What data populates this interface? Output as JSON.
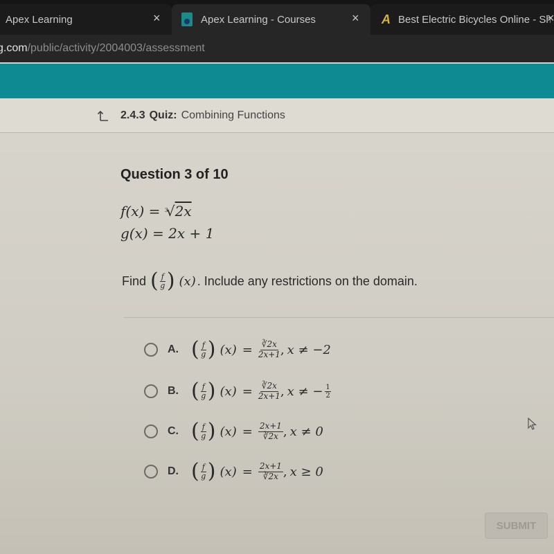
{
  "browser": {
    "tabs": [
      {
        "title": "Apex Learning",
        "favicon": "none",
        "active": false
      },
      {
        "title": "Apex Learning - Courses",
        "favicon": "apex-logo-icon",
        "active": true
      },
      {
        "title": "Best Electric Bicycles Online - Sh",
        "favicon": "a-logo-icon",
        "active": false
      }
    ],
    "close_glyph": "×",
    "url_host": "g.com",
    "url_path": "/public/activity/2004003/assessment"
  },
  "breadcrumb": {
    "number": "2.4.3",
    "type": "Quiz:",
    "title": "Combining Functions"
  },
  "question": {
    "header": "Question 3 of 10",
    "f_def": "f(x) = ∛(2x)",
    "f_lhs": "f(x) =",
    "f_rhs": "2x",
    "g_def": "g(x) = 2x + 1",
    "prompt_find": "Find",
    "prompt_frac_num": "f",
    "prompt_frac_den": "g",
    "prompt_arg": "(x)",
    "prompt_rest": ". Include any restrictions on the domain."
  },
  "choices": [
    {
      "letter": "A.",
      "lhs": "(x)",
      "num": "∛2x",
      "den": "2x+1",
      "condition": "x ≠ −2",
      "selected": false
    },
    {
      "letter": "B.",
      "lhs": "(x)",
      "num": "∛2x",
      "den": "2x+1",
      "condition": "x ≠ −",
      "condition_frac": {
        "num": "1",
        "den": "2"
      },
      "selected": false
    },
    {
      "letter": "C.",
      "lhs": "(x)",
      "num": "2x+1",
      "den": "∛2x",
      "condition": "x ≠ 0",
      "selected": false
    },
    {
      "letter": "D.",
      "lhs": "(x)",
      "num": "2x+1",
      "den": "∛2x",
      "condition": "x ≥ 0",
      "selected": false
    }
  ],
  "common": {
    "f": "f",
    "g": "g",
    "eq": "=",
    "comma": ","
  },
  "submit": {
    "label": "SUBMIT",
    "enabled": false
  },
  "colors": {
    "header_teal": "#0e8a93",
    "background": "#d6d3cb",
    "chrome_dark": "#151515"
  }
}
